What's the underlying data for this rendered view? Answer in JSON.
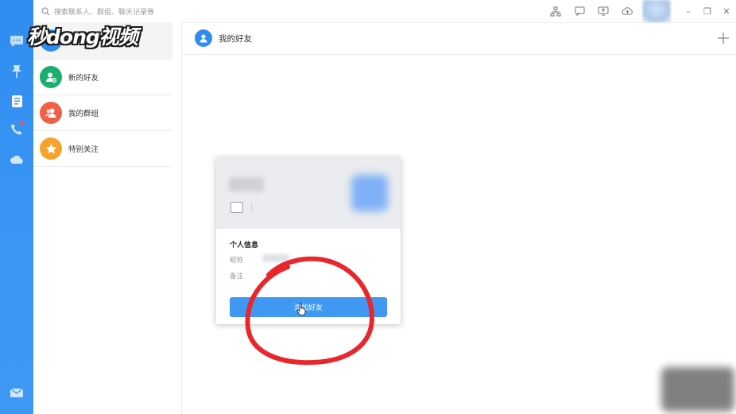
{
  "search": {
    "placeholder": "搜索联系人、群组、聊天记录等"
  },
  "watermark": {
    "text": "秒dong视频"
  },
  "contacts": {
    "items": [
      {
        "label": "新的好友",
        "color": "#1aaf6e",
        "icon": "person-add-icon"
      },
      {
        "label": "我的群组",
        "color": "#f06046",
        "icon": "group-icon"
      },
      {
        "label": "特别关注",
        "color": "#f7a22a",
        "icon": "star-icon"
      }
    ]
  },
  "main": {
    "title": "我的好友"
  },
  "card": {
    "section_title": "个人信息",
    "nickname_label": "昵称",
    "remark_label": "备注",
    "add_button": "添加好友",
    "more": "⋮"
  },
  "window": {
    "minimize": "–",
    "restore": "❐",
    "close": "✕"
  },
  "colors": {
    "accent": "#3f98f2",
    "rail": "#2f8df1",
    "annotation": "#e8262b"
  }
}
